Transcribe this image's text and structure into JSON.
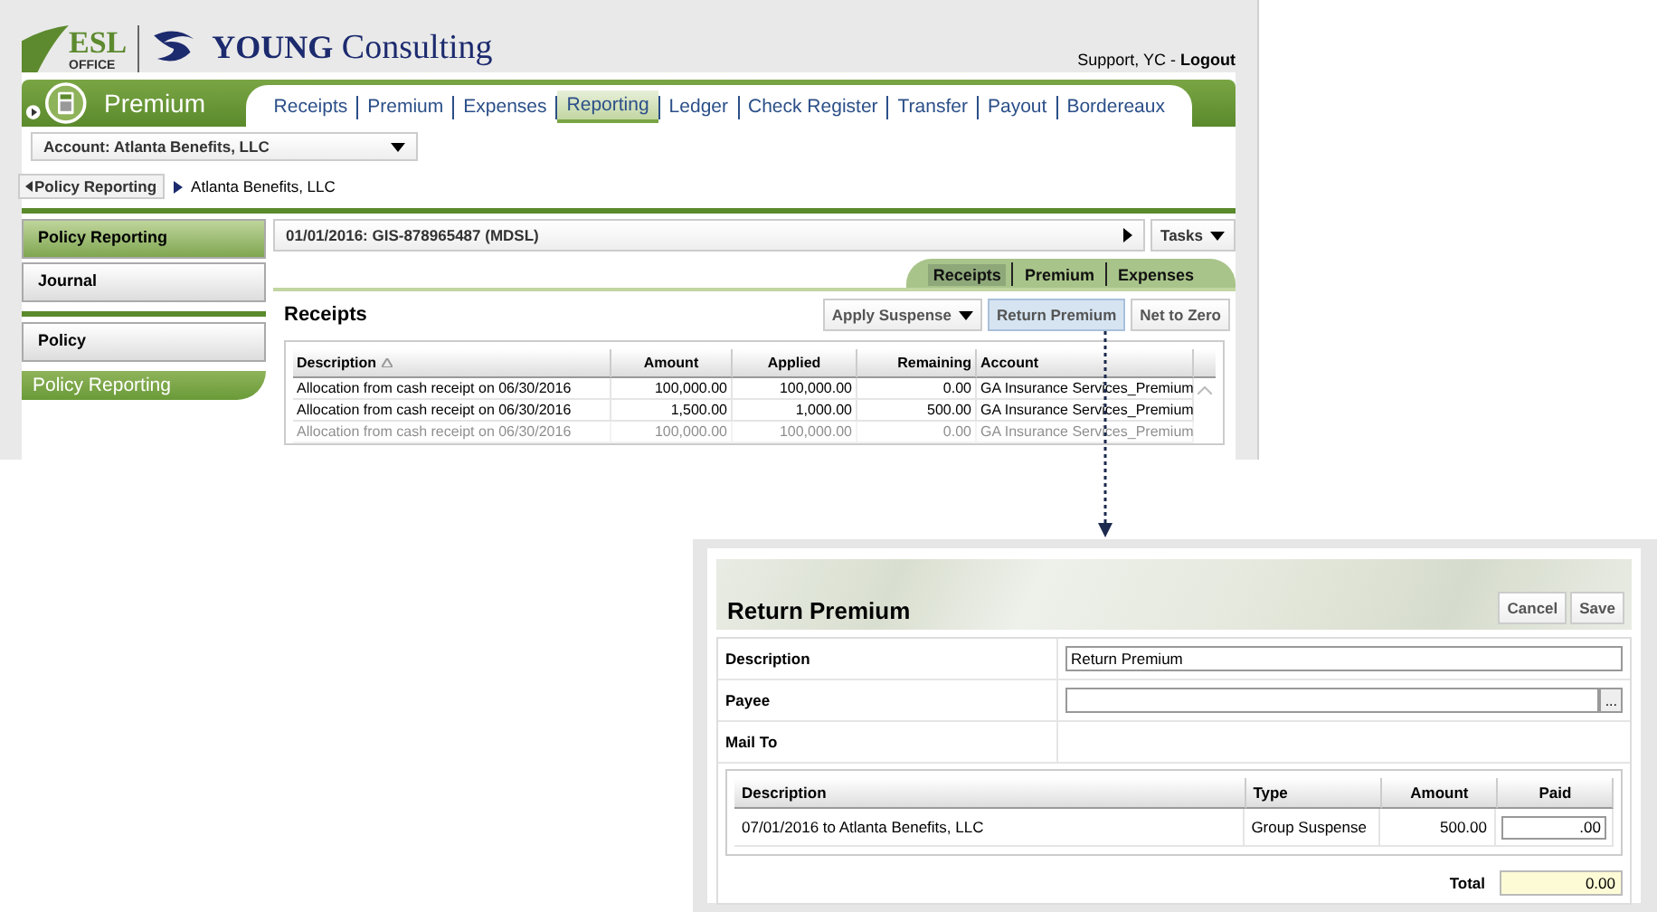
{
  "header": {
    "esl_logo": {
      "title": "ESL",
      "subtitle": "OFFICE"
    },
    "company_logo": {
      "strong": "YOUNG",
      "light": "Consulting"
    },
    "user": "Support, YC -",
    "logout": "Logout"
  },
  "module": {
    "title": "Premium",
    "nav": [
      {
        "label": "Receipts",
        "selected": false
      },
      {
        "label": "Premium",
        "selected": false
      },
      {
        "label": "Expenses",
        "selected": false
      },
      {
        "label": "Reporting",
        "selected": true
      },
      {
        "label": "Ledger",
        "selected": false
      },
      {
        "label": "Check Register",
        "selected": false
      },
      {
        "label": "Transfer",
        "selected": false
      },
      {
        "label": "Payout",
        "selected": false
      },
      {
        "label": "Bordereaux",
        "selected": false
      }
    ]
  },
  "account": {
    "value": "Account: Atlanta Benefits, LLC"
  },
  "breadcrumb": {
    "back": "Policy Reporting",
    "current": "Atlanta Benefits, LLC"
  },
  "sidebar": {
    "items": [
      {
        "label": "Policy Reporting",
        "selected": true
      },
      {
        "label": "Journal",
        "selected": false
      },
      {
        "label": "Policy",
        "selected": false
      }
    ],
    "section": "Policy Reporting"
  },
  "policy_bar": {
    "title": "01/01/2016: GIS-878965487 (MDSL)",
    "tasks": "Tasks"
  },
  "subtabs": [
    {
      "label": "Receipts",
      "selected": true
    },
    {
      "label": "Premium",
      "selected": false
    },
    {
      "label": "Expenses",
      "selected": false
    }
  ],
  "receipts": {
    "title": "Receipts",
    "actions": [
      {
        "label": "Apply Suspense",
        "kind": "dropdown",
        "highlighted": false
      },
      {
        "label": "Return Premium",
        "kind": "button",
        "highlighted": true
      },
      {
        "label": "Net to Zero",
        "kind": "button",
        "highlighted": false
      }
    ],
    "columns": [
      "Description",
      "Amount",
      "Applied",
      "Remaining",
      "Account"
    ],
    "rows": [
      {
        "cells": [
          "Allocation from cash receipt on 06/30/2016",
          "100,000.00",
          "100,000.00",
          "0.00",
          "GA Insurance Services_Premium"
        ],
        "faded": false
      },
      {
        "cells": [
          "Allocation from cash receipt on 06/30/2016",
          "1,500.00",
          "1,000.00",
          "500.00",
          "GA Insurance Services_Premium"
        ],
        "faded": false
      },
      {
        "cells": [
          "Allocation from cash receipt on 06/30/2016",
          "100,000.00",
          "100,000.00",
          "0.00",
          "GA Insurance Services_Premium"
        ],
        "faded": true
      }
    ]
  },
  "return_premium": {
    "title": "Return Premium",
    "buttons": [
      "Cancel",
      "Save"
    ],
    "fields": [
      {
        "label": "Description",
        "kind": "text",
        "value": "Return Premium"
      },
      {
        "label": "Payee",
        "kind": "lookup",
        "button": "..."
      },
      {
        "label": "Mail To",
        "kind": "static"
      }
    ],
    "columns": [
      "Description",
      "Type",
      "Amount",
      "Paid"
    ],
    "rows": [
      {
        "description": "07/01/2016 to Atlanta Benefits, LLC",
        "type": "Group Suspense",
        "amount": "500.00",
        "paid": ".00"
      }
    ],
    "total": {
      "label": "Total",
      "value": "0.00"
    }
  }
}
